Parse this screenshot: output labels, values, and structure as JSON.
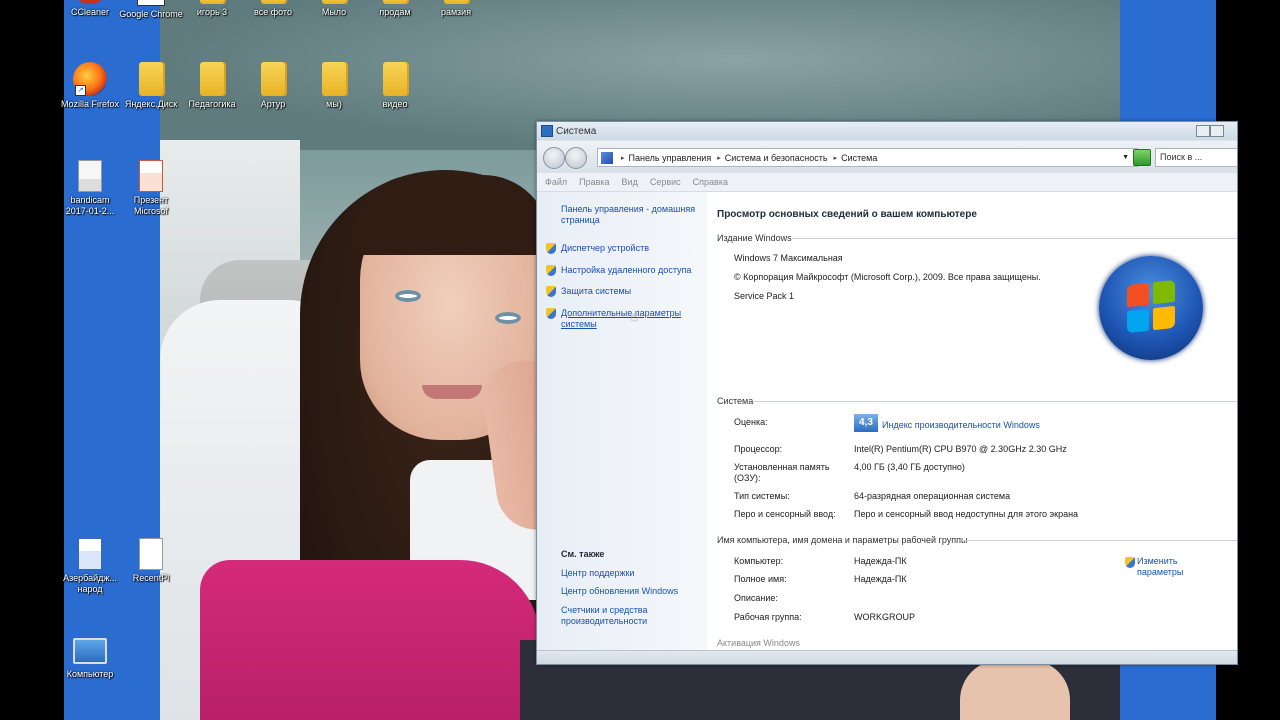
{
  "desktop": {
    "icons": [
      {
        "id": "ccleaner",
        "label": "CCleaner"
      },
      {
        "id": "chrome",
        "label": "Google Chrome"
      },
      {
        "id": "igor3",
        "label": "игорь 3"
      },
      {
        "id": "allphoto",
        "label": "все фото"
      },
      {
        "id": "mylo",
        "label": "Мыло"
      },
      {
        "id": "prodam",
        "label": "продам"
      },
      {
        "id": "ramziya",
        "label": "рамзия"
      },
      {
        "id": "firefox",
        "label": "Mozilla Firefox"
      },
      {
        "id": "yadisk",
        "label": "Яндекс.Диск"
      },
      {
        "id": "pedagogika",
        "label": "Педагогика"
      },
      {
        "id": "artur",
        "label": "Артур"
      },
      {
        "id": "my",
        "label": "мы)"
      },
      {
        "id": "video",
        "label": "видео"
      },
      {
        "id": "bandicam",
        "label": "bandicam 2017-01-2..."
      },
      {
        "id": "prezent",
        "label": "Презент Microsof"
      },
      {
        "id": "azer",
        "label": "Азербайдж... народ"
      },
      {
        "id": "recentpl",
        "label": "RecentPl"
      },
      {
        "id": "computer",
        "label": "Компьютер"
      }
    ]
  },
  "window": {
    "title": "Система",
    "breadcrumb": [
      "Панель управления",
      "Система и безопасность",
      "Система"
    ],
    "search_placeholder": "Поиск в ...",
    "menu": [
      "Файл",
      "Правка",
      "Вид",
      "Сервис",
      "Справка"
    ],
    "left_pane": {
      "home_link": "Панель управления - домашняя страница",
      "tasks": [
        "Диспетчер устройств",
        "Настройка удаленного доступа",
        "Защита системы",
        "Дополнительные параметры системы"
      ],
      "see_also_heading": "См. также",
      "see_also": [
        "Центр поддержки",
        "Центр обновления Windows",
        "Счетчики и средства производительности"
      ]
    },
    "main": {
      "title": "Просмотр основных сведений о вашем компьютере",
      "edition_section": "Издание Windows",
      "edition": "Windows 7 Максимальная",
      "copyright": "© Корпорация Майкрософт (Microsoft Corp.), 2009. Все права защищены.",
      "service_pack": "Service Pack 1",
      "system_section": "Система",
      "rows": [
        {
          "label": "Оценка:",
          "value": "Индекс производительности Windows"
        },
        {
          "label": "Процессор:",
          "value": "Intel(R) Pentium(R) CPU B970 @ 2.30GHz   2.30 GHz"
        },
        {
          "label": "Установленная память (ОЗУ):",
          "value": "4,00 ГБ (3,40 ГБ доступно)"
        },
        {
          "label": "Тип системы:",
          "value": "64-разрядная операционная система"
        },
        {
          "label": "Перо и сенсорный ввод:",
          "value": "Перо и сенсорный ввод недоступны для этого экрана"
        }
      ],
      "rating_value": "4,3",
      "computer_section": "Имя компьютера, имя домена и параметры рабочей группы",
      "computer_rows": [
        {
          "label": "Компьютер:",
          "value": "Надежда-ПК"
        },
        {
          "label": "Полное имя:",
          "value": "Надежда-ПК"
        },
        {
          "label": "Описание:",
          "value": ""
        },
        {
          "label": "Рабочая группа:",
          "value": "WORKGROUP"
        }
      ],
      "change_link": "Изменить параметры",
      "activation_section": "Активация Windows"
    }
  },
  "colors": {
    "link": "#1a4fb0",
    "desktop": "#2a6cd0"
  }
}
